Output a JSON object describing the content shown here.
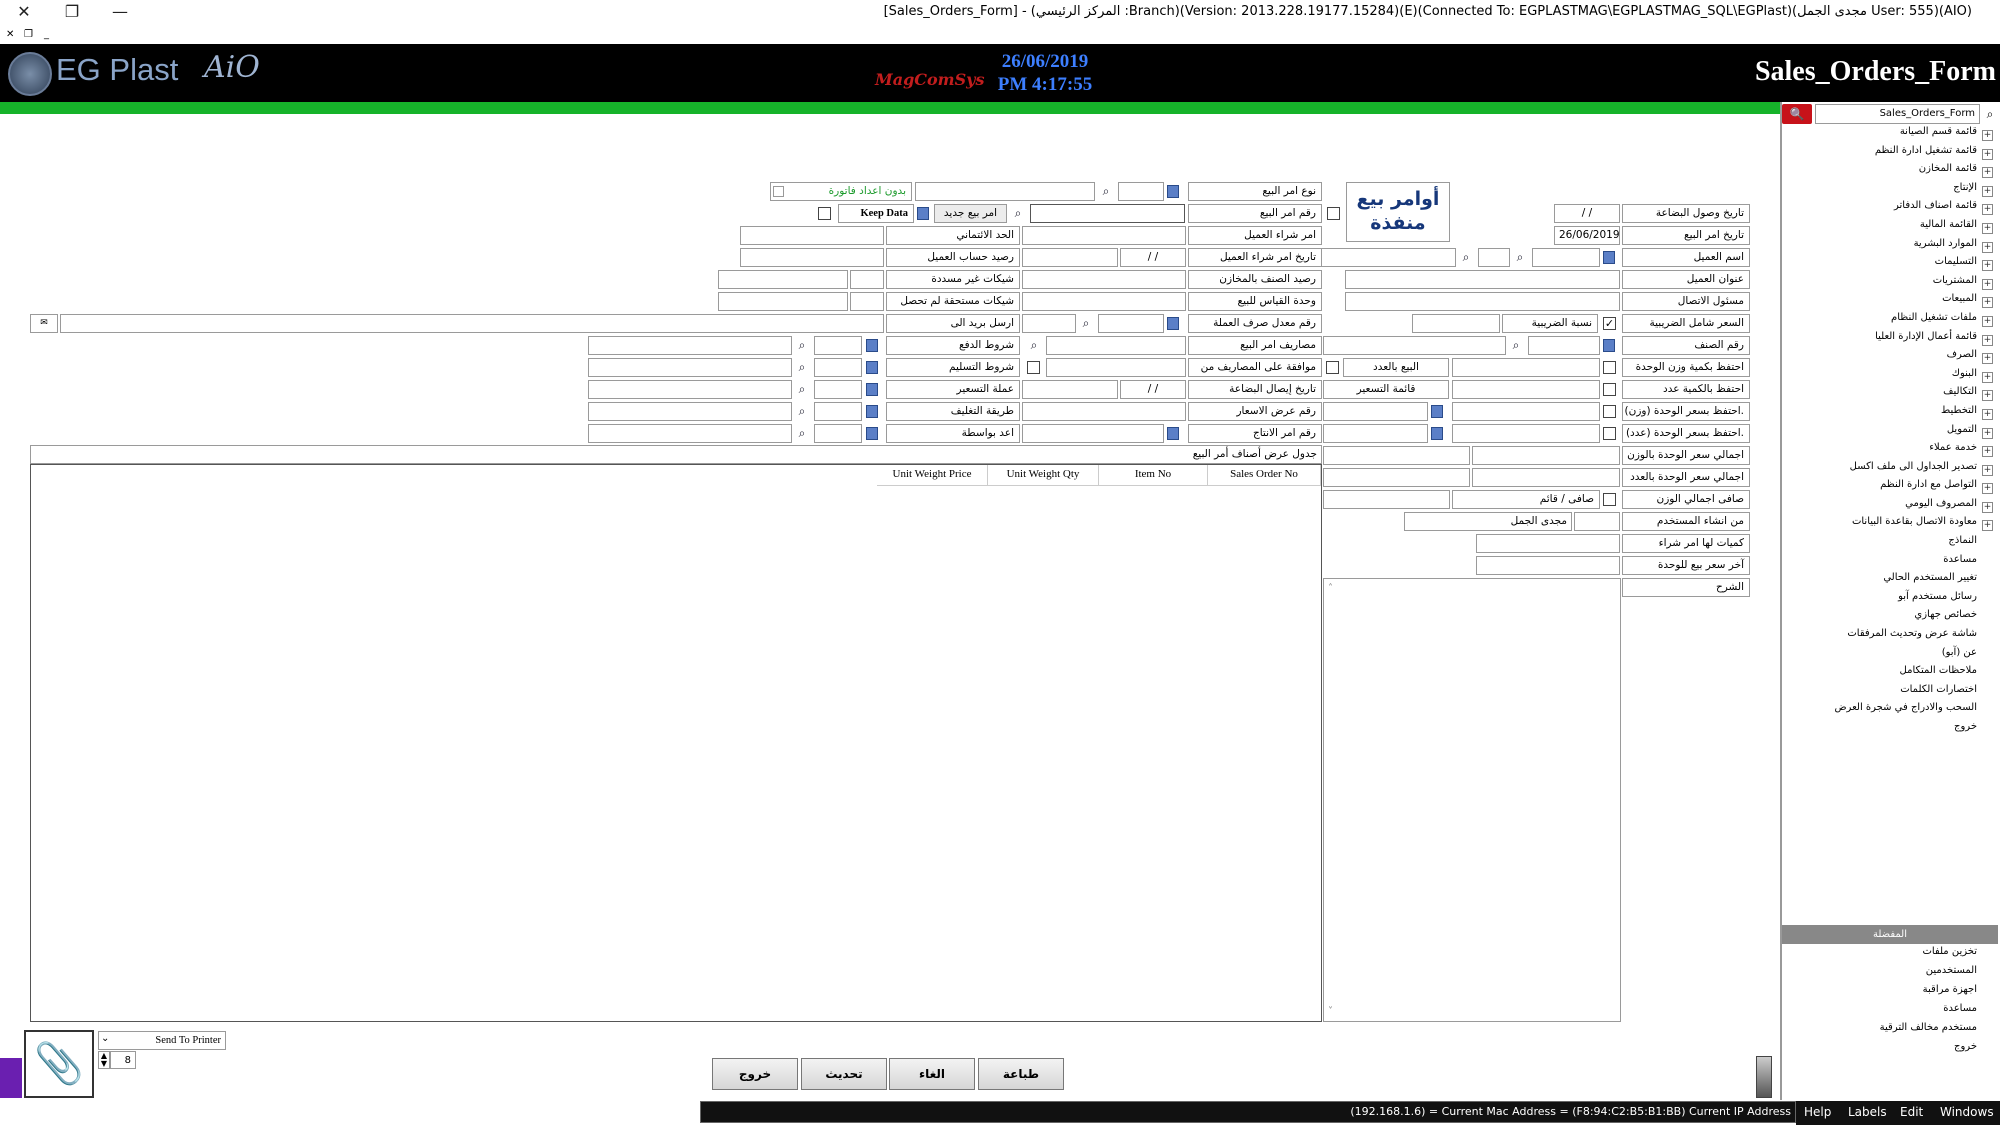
{
  "window": {
    "title": "[Sales_Orders_Form] - (المركز الرئيسي :Branch)(Version: 2013.228.19177.15284)(E)(Connected To: EGPLASTMAG\\EGPLASTMAG_SQL\\EGPlast)(مجدى الجمل User: 555)(AIO)"
  },
  "header": {
    "logo_text": "EG Plast",
    "logo_suffix": "AiO",
    "mid_logo": "MagComSys",
    "date": "26/06/2019",
    "time": "PM 4:17:55",
    "form_title": "Sales_Orders_Form"
  },
  "sidebar": {
    "search_value": "Sales_Orders_Form",
    "items": [
      "قائمة قسم الصيانة",
      "قائمة تشغيل ادارة النظم",
      "قائمة المخازن",
      "الإنتاج",
      "قائمة اصناف الدفاتر",
      "القائمة المالية",
      "الموارد البشرية",
      "التسليمات",
      "المشتريات",
      "المبيعات",
      "ملفات تشغيل النظام",
      "قائمة أعمال الإدارة العليا",
      "الصرف",
      "البنوك",
      "التكاليف",
      "التخطيط",
      "التمويل",
      "خدمة عملاء",
      "تصدير الجداول الى ملف اكسل",
      "التواصل مع ادارة النظم",
      "المصروف اليومي",
      "معاودة الاتصال بقاعدة البيانات",
      "النماذج",
      "مساعدة",
      "تغيير المستخدم الحالي",
      "رسائل مستخدم آبو",
      "خصائص جهازي",
      "شاشة عرض وتحديث المرفقات",
      "عن (آبو)",
      "ملاحظات المتكامل",
      "اختصارات الكلمات",
      "السحب والادراج في شجرة العرض",
      "خروج"
    ],
    "favorites_title": "المفضلة",
    "favorites": [
      "تخزين ملفات",
      "المستخدمين",
      "اجهزة مراقبة",
      "مساعدة",
      "مستخدم مخالف الترقية",
      "خروج"
    ]
  },
  "form": {
    "big_title": "أوامر بيع منفذة",
    "no_invoice_label": "بدون اعداد فاتورة",
    "keep_data": "Keep Data",
    "new_order": "امر بيع جديد",
    "labels": {
      "arrival_date": "تاريخ وصول البضاعة",
      "order_date": "تاريخ امر البيع",
      "customer_name": "اسم العميل",
      "customer_address": "عنوان العميل",
      "contact_person": "مسئول الاتصال",
      "price_incl_tax": "السعر شامل الضريبية",
      "tax_ratio": "نسبة الضريبية",
      "item_no": "رقم الصنف",
      "keep_weight_qty": "احتفظ بكمية وزن الوحدة",
      "sell_by_count": "البيع بالعدد",
      "keep_count_qty": "احتفظ بالكمية عدد",
      "price_list": "قائمة التسعير",
      "keep_weight_price": "احتفظ بسعر الوحدة (وزن).",
      "keep_count_price": "احتفظ بسعر الوحدة (عدد).",
      "total_price_weight": "اجمالي سعر الوحدة بالوزن",
      "total_price_count": "اجمالي سعر الوحدة بالعدد",
      "net_total_weight": "صافى اجمالي الوزن",
      "net_gross": "صافى / قائم",
      "created_by": "من انشاء المستخدم",
      "created_by_value": "مجدى الجمل",
      "qty_with_po": "كميات لها امر شراء",
      "last_price": "آخر سعر بيع للوحدة",
      "explanation": "الشرح",
      "order_type": "نوع امر البيع",
      "order_no": "رقم امر البيع",
      "customer_po": "امر شراء العميل",
      "customer_po_date": "تاريخ امر شراء العميل",
      "item_stock": "رصيد الصنف بالمخازن",
      "sale_unit": "وحدة القياس للبيع",
      "currency_rate": "رقم معدل صرف العملة",
      "order_expenses": "مصاريف امر البيع",
      "expenses_approval": "موافقة على المصاريف من",
      "delivery_date": "تاريخ إيصال البضاعة",
      "quote_no": "رقم عرض الاسعار",
      "production_order_no": "رقم امر الانتاج",
      "credit_limit": "الحد الائتماني",
      "customer_balance": "رصيد حساب العميل",
      "unpaid_cheques": "شيكات غير مسددة",
      "due_cheques": "شيكات مستحقة لم تحصل",
      "send_email": "ارسل بريد الى",
      "payment_terms": "شروط الدفع",
      "delivery_terms": "شروط التسليم",
      "pricing_currency": "عملة التسعير",
      "packing_method": "طريقة التغليف",
      "prepared_by": "اعد بواسطة"
    },
    "values": {
      "arrival_date": "/ /",
      "order_date": "26/06/2019",
      "customer_po_date": "/ /",
      "delivery_date": "/ /"
    },
    "grid_title": "جدول عرض أصناف أمر البيع",
    "grid_columns": [
      "Sales Order No",
      "Item No",
      "Unit Weight Qty",
      "Unit Weight Price"
    ]
  },
  "footer": {
    "send_to_printer": "Send To Printer",
    "copies": "8",
    "buttons": {
      "print": "طباعة",
      "cancel": "الغاء",
      "update": "تحديث",
      "exit": "خروج"
    },
    "status": "(192.168.1.6) = Current Mac Address = (F8:94:C2:B5:B1:BB) Current IP Address",
    "menu": [
      "Help",
      "Labels",
      "Edit",
      "Windows"
    ]
  }
}
